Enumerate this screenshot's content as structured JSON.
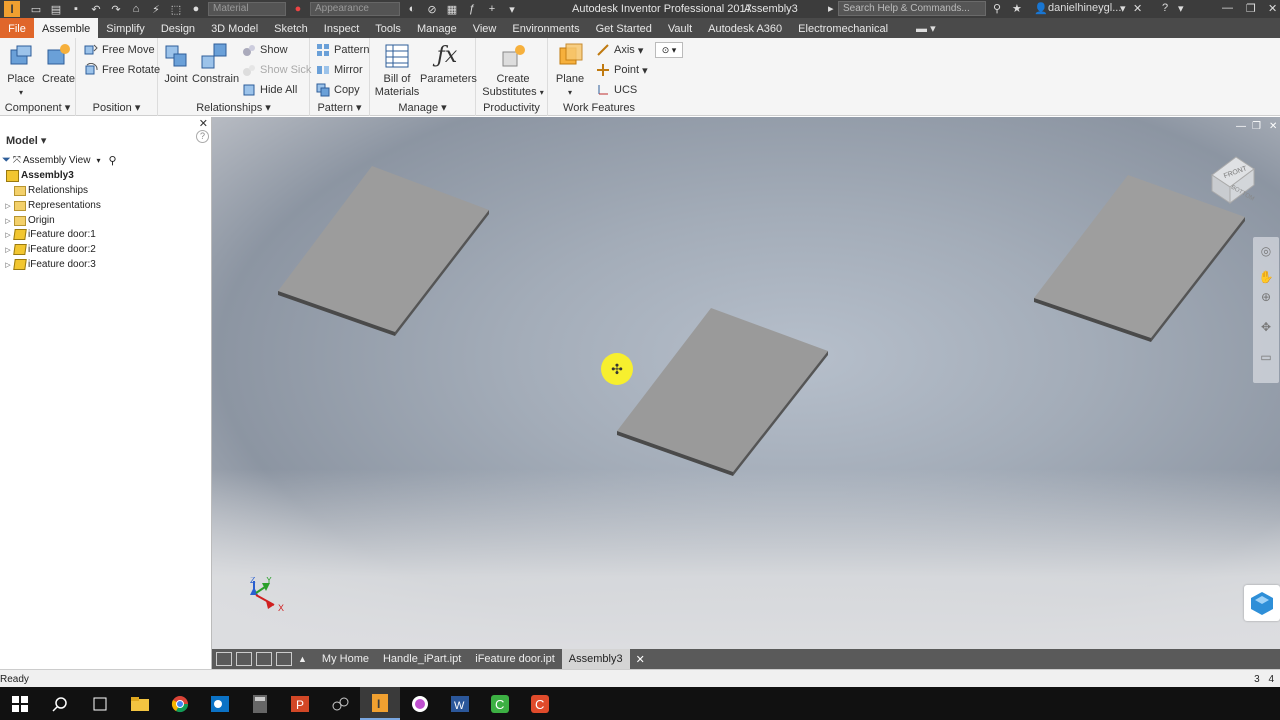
{
  "window": {
    "title": "Autodesk Inventor Professional 2017",
    "document": "Assembly3",
    "qat_material": "Material",
    "qat_appearance": "Appearance",
    "search_placeholder": "Search Help & Commands...",
    "user": "danielhineygl..."
  },
  "tabs": [
    "File",
    "Assemble",
    "Simplify",
    "Design",
    "3D Model",
    "Sketch",
    "Inspect",
    "Tools",
    "Manage",
    "View",
    "Environments",
    "Get Started",
    "Vault",
    "Autodesk A360",
    "Electromechanical"
  ],
  "active_tab": "Assemble",
  "ribbon": {
    "component": {
      "label": "Component",
      "place": "Place",
      "create": "Create"
    },
    "position": {
      "label": "Position",
      "free_move": "Free Move",
      "free_rotate": "Free Rotate"
    },
    "relationships": {
      "label": "Relationships",
      "joint": "Joint",
      "constrain": "Constrain",
      "show": "Show",
      "show_sick": "Show Sick",
      "hide_all": "Hide All"
    },
    "pattern": {
      "label": "Pattern",
      "pattern": "Pattern",
      "mirror": "Mirror",
      "copy": "Copy"
    },
    "manage": {
      "label": "Manage",
      "bom_line1": "Bill of",
      "bom_line2": "Materials",
      "parameters": "Parameters"
    },
    "productivity": {
      "label": "Productivity",
      "create_sub_line1": "Create",
      "create_sub_line2": "Substitutes"
    },
    "work_features": {
      "label": "Work Features",
      "plane": "Plane",
      "axis": "Axis",
      "point": "Point",
      "ucs": "UCS"
    }
  },
  "browser": {
    "title": "Model",
    "view": "Assembly View",
    "root": "Assembly3",
    "items": [
      {
        "label": "Relationships",
        "expandable": false
      },
      {
        "label": "Representations",
        "expandable": true
      },
      {
        "label": "Origin",
        "expandable": true
      },
      {
        "label": "iFeature door:1",
        "expandable": true
      },
      {
        "label": "iFeature door:2",
        "expandable": true
      },
      {
        "label": "iFeature door:3",
        "expandable": true
      }
    ]
  },
  "viewcube": {
    "front": "FRONT",
    "bottom": "BOTTOM"
  },
  "triad": {
    "x": "X",
    "y": "Y",
    "z": "Z"
  },
  "doc_tabs": [
    "My Home",
    "Handle_iPart.ipt",
    "iFeature door.ipt",
    "Assembly3"
  ],
  "active_doc": "Assembly3",
  "status": {
    "text": "Ready",
    "n1": "3",
    "n2": "4"
  },
  "colors": {
    "file_tab": "#e0662a",
    "plate": "#9a9a9a",
    "highlight": "#fff51e"
  }
}
